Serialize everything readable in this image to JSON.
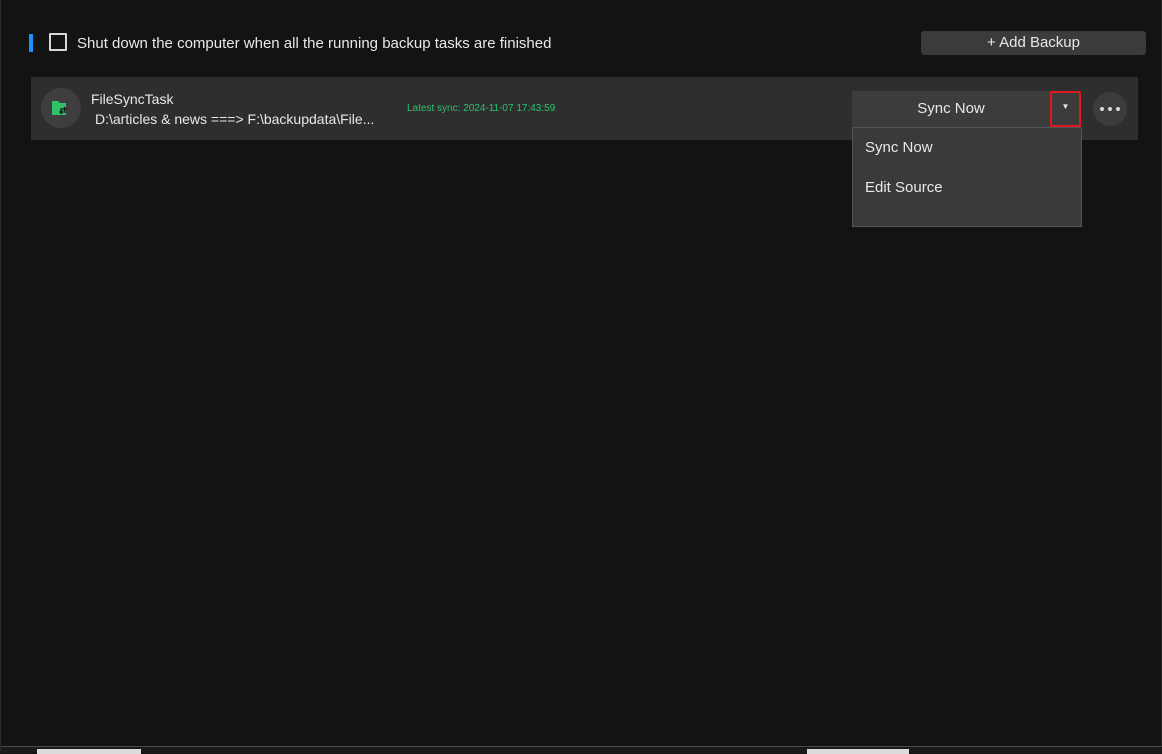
{
  "header": {
    "shutdown_checked": false,
    "shutdown_label": "Shut down the computer when all the running backup tasks are finished",
    "add_backup_label": "+ Add Backup",
    "accent_color": "#1f8fff"
  },
  "task": {
    "icon": "folder-sync-icon",
    "name": "FileSyncTask",
    "path": "D:\\articles & news ===> F:\\backupdata\\File...",
    "latest_sync": "Latest sync: 2024-11-07 17:43:59",
    "latest_sync_color": "#2fc26b",
    "sync_now_label": "Sync Now",
    "dropdown_glyph": "▼",
    "more_icon": "more-dots-icon"
  },
  "dropdown_menu": {
    "items": [
      {
        "label": "Sync Now"
      },
      {
        "label": "Edit Source"
      }
    ]
  },
  "highlight_color": "#e0181f"
}
